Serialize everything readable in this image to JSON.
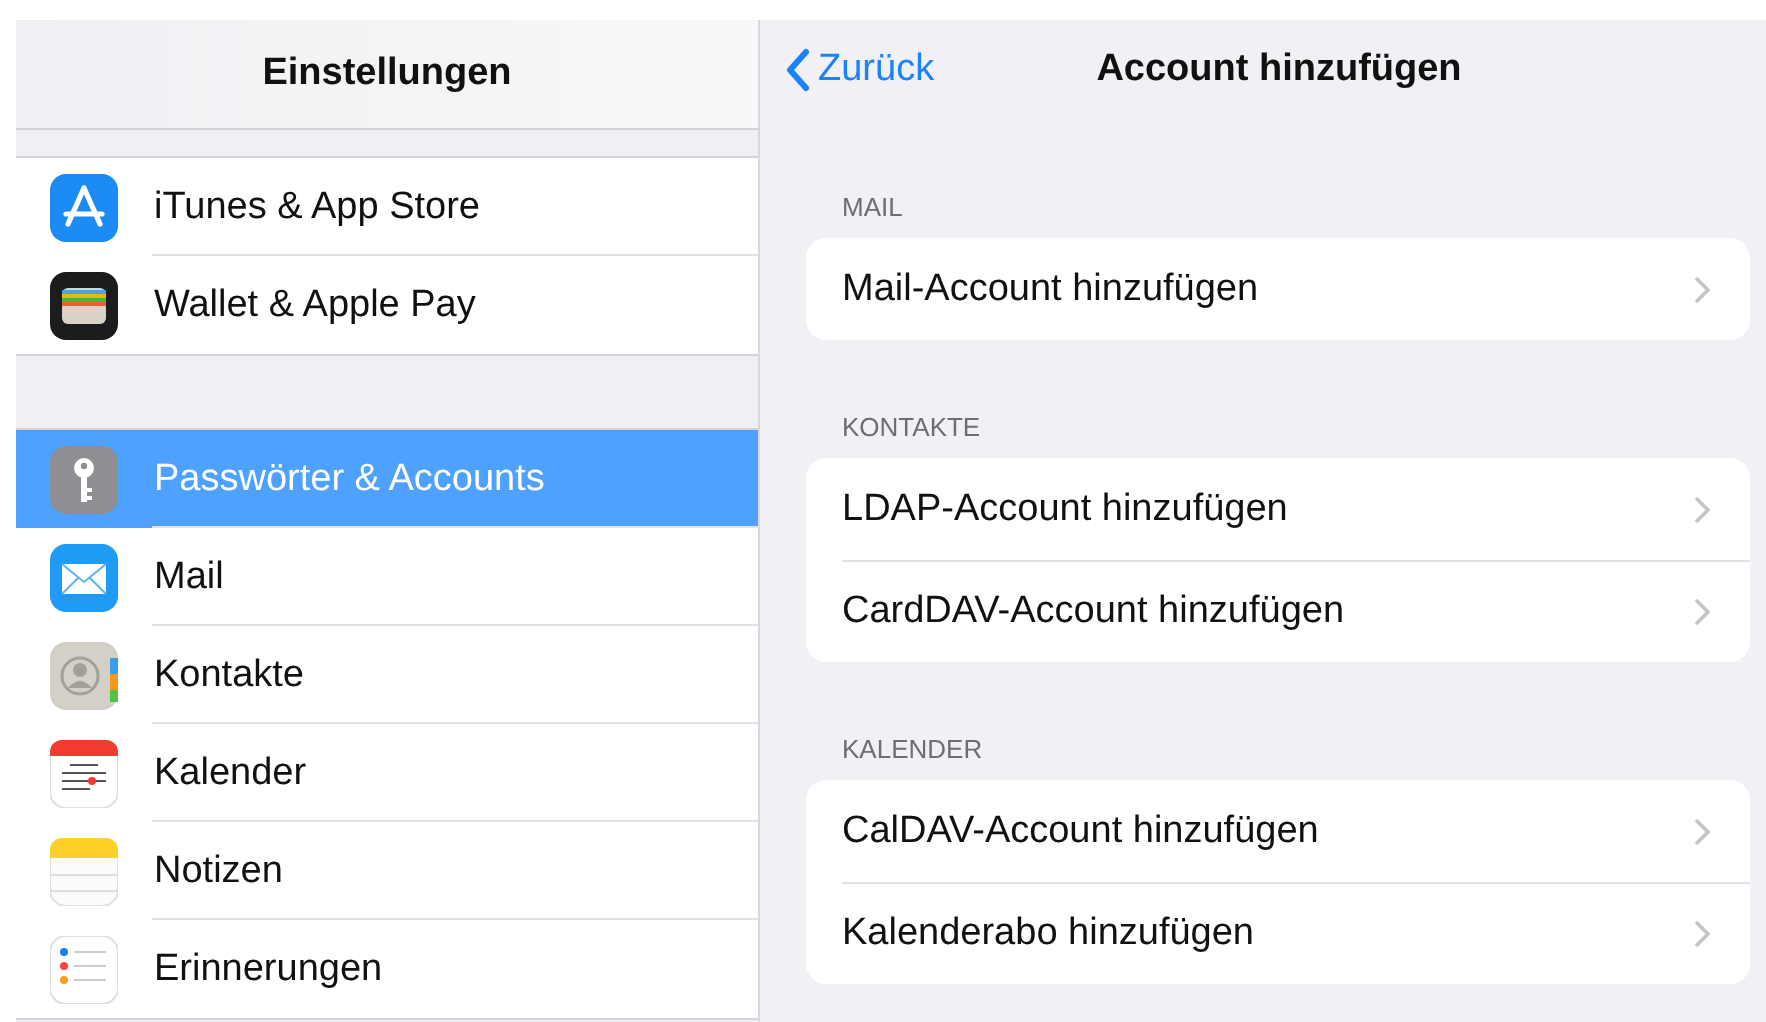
{
  "sidebar": {
    "title": "Einstellungen",
    "groups": [
      {
        "items": [
          {
            "label": "iTunes & App Store",
            "kind": "appstore",
            "selected": false
          },
          {
            "label": "Wallet & Apple Pay",
            "kind": "wallet",
            "selected": false
          }
        ]
      },
      {
        "items": [
          {
            "label": "Passwörter & Accounts",
            "kind": "key",
            "selected": true
          },
          {
            "label": "Mail",
            "kind": "mail",
            "selected": false
          },
          {
            "label": "Kontakte",
            "kind": "contacts",
            "selected": false
          },
          {
            "label": "Kalender",
            "kind": "calendar",
            "selected": false
          },
          {
            "label": "Notizen",
            "kind": "notes",
            "selected": false
          },
          {
            "label": "Erinnerungen",
            "kind": "reminders",
            "selected": false
          }
        ]
      }
    ]
  },
  "detail": {
    "back": "Zurück",
    "title": "Account hinzufügen",
    "sections": [
      {
        "header": "MAIL",
        "rows": [
          "Mail-Account hinzufügen"
        ]
      },
      {
        "header": "KONTAKTE",
        "rows": [
          "LDAP-Account hinzufügen",
          "CardDAV-Account hinzufügen"
        ]
      },
      {
        "header": "KALENDER",
        "rows": [
          "CalDAV-Account hinzufügen",
          "Kalenderabo hinzufügen"
        ]
      }
    ]
  }
}
